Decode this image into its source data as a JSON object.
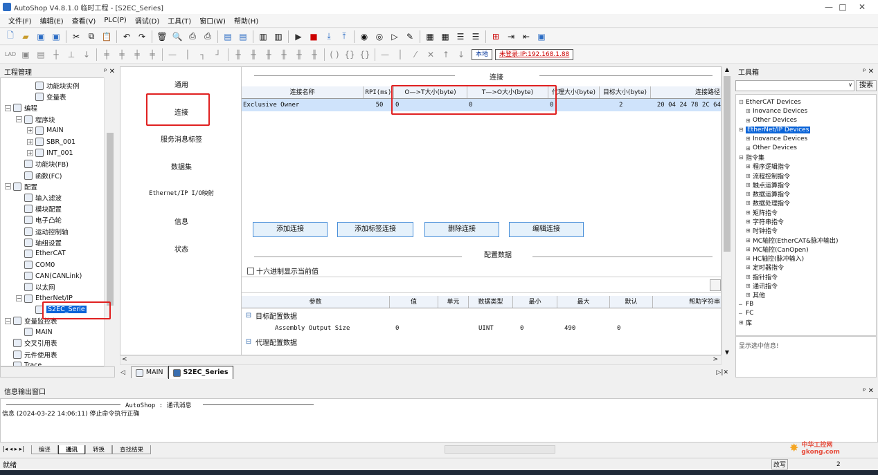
{
  "window": {
    "title": "AutoShop V4.8.1.0 临时工程 - [S2EC_Series]",
    "controls": [
      "—",
      "□",
      "✕"
    ]
  },
  "menu": [
    "文件(F)",
    "编辑(E)",
    "查看(V)",
    "PLC(P)",
    "调试(D)",
    "工具(T)",
    "窗口(W)",
    "帮助(H)"
  ],
  "toolbar": {
    "local_label": "本地",
    "login_label": "未登录:IP:192.168.1.88"
  },
  "project_panel": {
    "title": "工程管理",
    "items": [
      {
        "label": "功能块实例",
        "indent": 2,
        "expander": ""
      },
      {
        "label": "变量表",
        "indent": 2,
        "expander": ""
      },
      {
        "label": "编程",
        "indent": 0,
        "expander": "−"
      },
      {
        "label": "程序块",
        "indent": 1,
        "expander": "−"
      },
      {
        "label": "MAIN",
        "indent": 2,
        "expander": "+"
      },
      {
        "label": "SBR_001",
        "indent": 2,
        "expander": "+"
      },
      {
        "label": "INT_001",
        "indent": 2,
        "expander": "+"
      },
      {
        "label": "功能块(FB)",
        "indent": 1,
        "expander": ""
      },
      {
        "label": "函数(FC)",
        "indent": 1,
        "expander": ""
      },
      {
        "label": "配置",
        "indent": 0,
        "expander": "−"
      },
      {
        "label": "输入滤波",
        "indent": 1,
        "expander": ""
      },
      {
        "label": "模块配置",
        "indent": 1,
        "expander": ""
      },
      {
        "label": "电子凸轮",
        "indent": 1,
        "expander": ""
      },
      {
        "label": "运动控制轴",
        "indent": 1,
        "expander": ""
      },
      {
        "label": "轴组设置",
        "indent": 1,
        "expander": ""
      },
      {
        "label": "EtherCAT",
        "indent": 1,
        "expander": ""
      },
      {
        "label": "COM0",
        "indent": 1,
        "expander": ""
      },
      {
        "label": "CAN(CANLink)",
        "indent": 1,
        "expander": ""
      },
      {
        "label": "以太网",
        "indent": 1,
        "expander": ""
      },
      {
        "label": "EtherNet/IP",
        "indent": 1,
        "expander": "−"
      },
      {
        "label": "S2EC_Serie",
        "indent": 2,
        "expander": "",
        "selected": true
      },
      {
        "label": "变量监控表",
        "indent": 0,
        "expander": "−"
      },
      {
        "label": "MAIN",
        "indent": 1,
        "expander": ""
      },
      {
        "label": "交叉引用表",
        "indent": 0,
        "expander": ""
      },
      {
        "label": "元件使用表",
        "indent": 0,
        "expander": ""
      },
      {
        "label": "Trace",
        "indent": 0,
        "expander": ""
      }
    ]
  },
  "config_tabs": [
    "通用",
    "连接",
    "服务消息标签",
    "数据集",
    "Ethernet/IP I/O映射",
    "信息",
    "状态"
  ],
  "connection": {
    "section_title": "连接",
    "columns": [
      "连接名称",
      "RPI(ms)",
      "O—>T大小(byte)",
      "T—>O大小(byte)",
      "代理大小(byte)",
      "目标大小(byte)",
      "连接路径"
    ],
    "rows": [
      [
        "Exclusive Owner",
        "50",
        "0",
        "0",
        "0",
        "2",
        "20 04 24 78 2C 64"
      ]
    ],
    "buttons": [
      "添加连接",
      "添加标签连接",
      "删除连接",
      "编辑连接"
    ]
  },
  "config_data": {
    "section_title": "配置数据",
    "hex_checkbox_label": "十六进制显示当前值",
    "columns": [
      "参数",
      "值",
      "单元",
      "数据类型",
      "最小",
      "最大",
      "默认",
      "帮助字符串"
    ],
    "groups": [
      {
        "label": "目标配置数据",
        "rows": [
          [
            "Assembly Output Size",
            "0",
            "",
            "UINT",
            "0",
            "490",
            "0",
            ""
          ]
        ]
      },
      {
        "label": "代理配置数据",
        "rows": []
      }
    ]
  },
  "editor_tabs": [
    "MAIN",
    "S2EC_Series"
  ],
  "toolbox": {
    "title": "工具箱",
    "search_label": "搜索",
    "items": [
      {
        "label": "EtherCAT Devices",
        "indent": 0,
        "expander": "−"
      },
      {
        "label": "Inovance Devices",
        "indent": 1,
        "expander": "+"
      },
      {
        "label": "Other Devices",
        "indent": 1,
        "expander": "+"
      },
      {
        "label": "EtherNet/IP Devices",
        "indent": 0,
        "expander": "−",
        "selected": true
      },
      {
        "label": "Inovance Devices",
        "indent": 1,
        "expander": "+"
      },
      {
        "label": "Other Devices",
        "indent": 1,
        "expander": "+"
      },
      {
        "label": "指令集",
        "indent": 0,
        "expander": "−"
      },
      {
        "label": "程序逻辑指令",
        "indent": 1,
        "expander": "+"
      },
      {
        "label": "流程控制指令",
        "indent": 1,
        "expander": "+"
      },
      {
        "label": "触点运算指令",
        "indent": 1,
        "expander": "+"
      },
      {
        "label": "数据运算指令",
        "indent": 1,
        "expander": "+"
      },
      {
        "label": "数据处理指令",
        "indent": 1,
        "expander": "+"
      },
      {
        "label": "矩阵指令",
        "indent": 1,
        "expander": "+"
      },
      {
        "label": "字符串指令",
        "indent": 1,
        "expander": "+"
      },
      {
        "label": "时钟指令",
        "indent": 1,
        "expander": "+"
      },
      {
        "label": "MC轴控(EtherCAT&脉冲输出)",
        "indent": 1,
        "expander": "+"
      },
      {
        "label": "MC轴控(CanOpen)",
        "indent": 1,
        "expander": "+"
      },
      {
        "label": "HC轴控(脉冲输入)",
        "indent": 1,
        "expander": "+"
      },
      {
        "label": "定时器指令",
        "indent": 1,
        "expander": "+"
      },
      {
        "label": "指针指令",
        "indent": 1,
        "expander": "+"
      },
      {
        "label": "通讯指令",
        "indent": 1,
        "expander": "+"
      },
      {
        "label": "其他",
        "indent": 1,
        "expander": "+"
      },
      {
        "label": "FB",
        "indent": 0,
        "expander": ""
      },
      {
        "label": "FC",
        "indent": 0,
        "expander": ""
      },
      {
        "label": "库",
        "indent": 0,
        "expander": "+"
      }
    ],
    "info_text": "显示选中信息!"
  },
  "output": {
    "title": "信息输出窗口",
    "header": "AutoShop : 通讯消息",
    "message": "信息  (2024-03-22 14:06:11)  停止命令执行正确",
    "tabs": [
      "编译",
      "通讯",
      "转换",
      "查找结果"
    ]
  },
  "status": {
    "left": "就绪",
    "right": "改写",
    "page": "2"
  },
  "watermark": "中华工控网 gkong.com"
}
